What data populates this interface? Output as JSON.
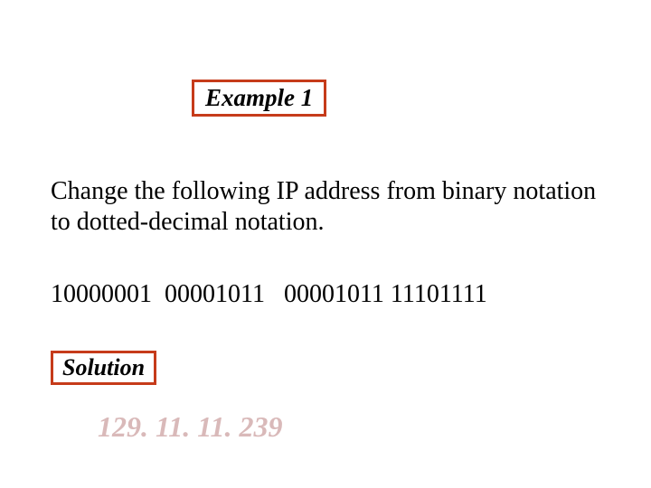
{
  "example_label": "Example 1",
  "prompt_text": "Change the following IP address from binary notation to dotted-decimal notation.",
  "binary_line": "10000001  00001011   00001011 11101111",
  "solution_label": "Solution",
  "answer_text": "129. 11. 11. 239"
}
